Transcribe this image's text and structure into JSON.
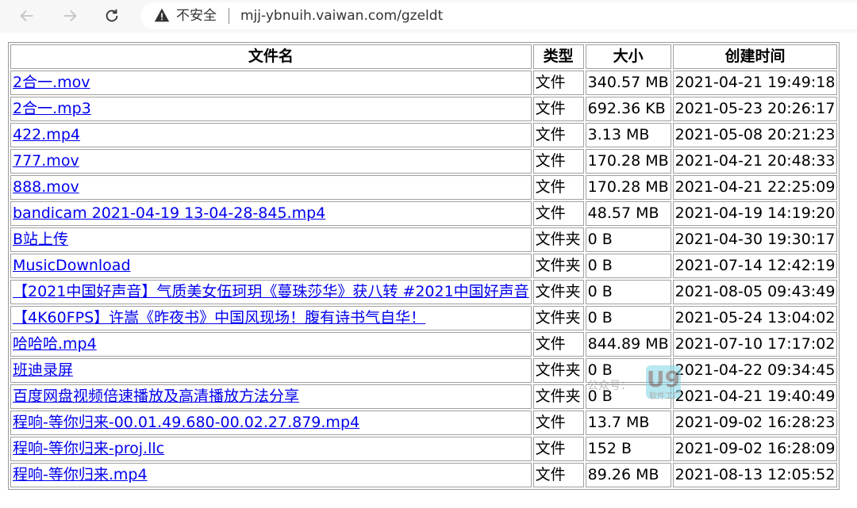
{
  "browser": {
    "security_label": "不安全",
    "url": "mjj-ybnuih.vaiwan.com/gzeldt",
    "icons": {
      "back": "back-arrow-icon",
      "forward": "forward-arrow-icon",
      "reload": "reload-icon",
      "warning": "warning-icon"
    }
  },
  "table": {
    "headers": {
      "name": "文件名",
      "type": "类型",
      "size": "大小",
      "created": "创建时间"
    },
    "rows": [
      {
        "name": "2合一.mov",
        "type": "文件",
        "size": "340.57 MB",
        "created": "2021-04-21 19:49:18"
      },
      {
        "name": "2合一.mp3",
        "type": "文件",
        "size": "692.36 KB",
        "created": "2021-05-23 20:26:17"
      },
      {
        "name": "422.mp4",
        "type": "文件",
        "size": "3.13 MB",
        "created": "2021-05-08 20:21:23"
      },
      {
        "name": "777.mov",
        "type": "文件",
        "size": "170.28 MB",
        "created": "2021-04-21 20:48:33"
      },
      {
        "name": "888.mov",
        "type": "文件",
        "size": "170.28 MB",
        "created": "2021-04-21 22:25:09"
      },
      {
        "name": "bandicam 2021-04-19 13-04-28-845.mp4",
        "type": "文件",
        "size": "48.57 MB",
        "created": "2021-04-19 14:19:20"
      },
      {
        "name": "B站上传",
        "type": "文件夹",
        "size": "0 B",
        "created": "2021-04-30 19:30:17"
      },
      {
        "name": "MusicDownload",
        "type": "文件夹",
        "size": "0 B",
        "created": "2021-07-14 12:42:19"
      },
      {
        "name": "【2021中国好声音】气质美女伍珂玥《蔓珠莎华》获八转 #2021中国好声音",
        "type": "文件夹",
        "size": "0 B",
        "created": "2021-08-05 09:43:49"
      },
      {
        "name": "【4K60FPS】许嵩《昨夜书》中国风现场！腹有诗书气自华！",
        "type": "文件夹",
        "size": "0 B",
        "created": "2021-05-24 13:04:02"
      },
      {
        "name": "哈哈哈.mp4",
        "type": "文件",
        "size": "844.89 MB",
        "created": "2021-07-10 17:17:02"
      },
      {
        "name": "班迪录屏",
        "type": "文件夹",
        "size": "0 B",
        "created": "2021-04-22 09:34:45"
      },
      {
        "name": "百度网盘视频倍速播放及高清播放方法分享",
        "type": "文件夹",
        "size": "0 B",
        "created": "2021-04-21 19:40:49"
      },
      {
        "name": "程响-等你归来-00.01.49.680-00.02.27.879.mp4",
        "type": "文件",
        "size": "13.7 MB",
        "created": "2021-09-02 16:28:23"
      },
      {
        "name": "程响-等你归来-proj.llc",
        "type": "文件",
        "size": "152 B",
        "created": "2021-09-02 16:28:09"
      },
      {
        "name": "程响-等你归来.mp4",
        "type": "文件",
        "size": "89.26 MB",
        "created": "2021-08-13 12:05:52"
      }
    ]
  },
  "watermark": {
    "prefix": "公众号：",
    "logo": "U9",
    "sub": "软件工厂"
  }
}
